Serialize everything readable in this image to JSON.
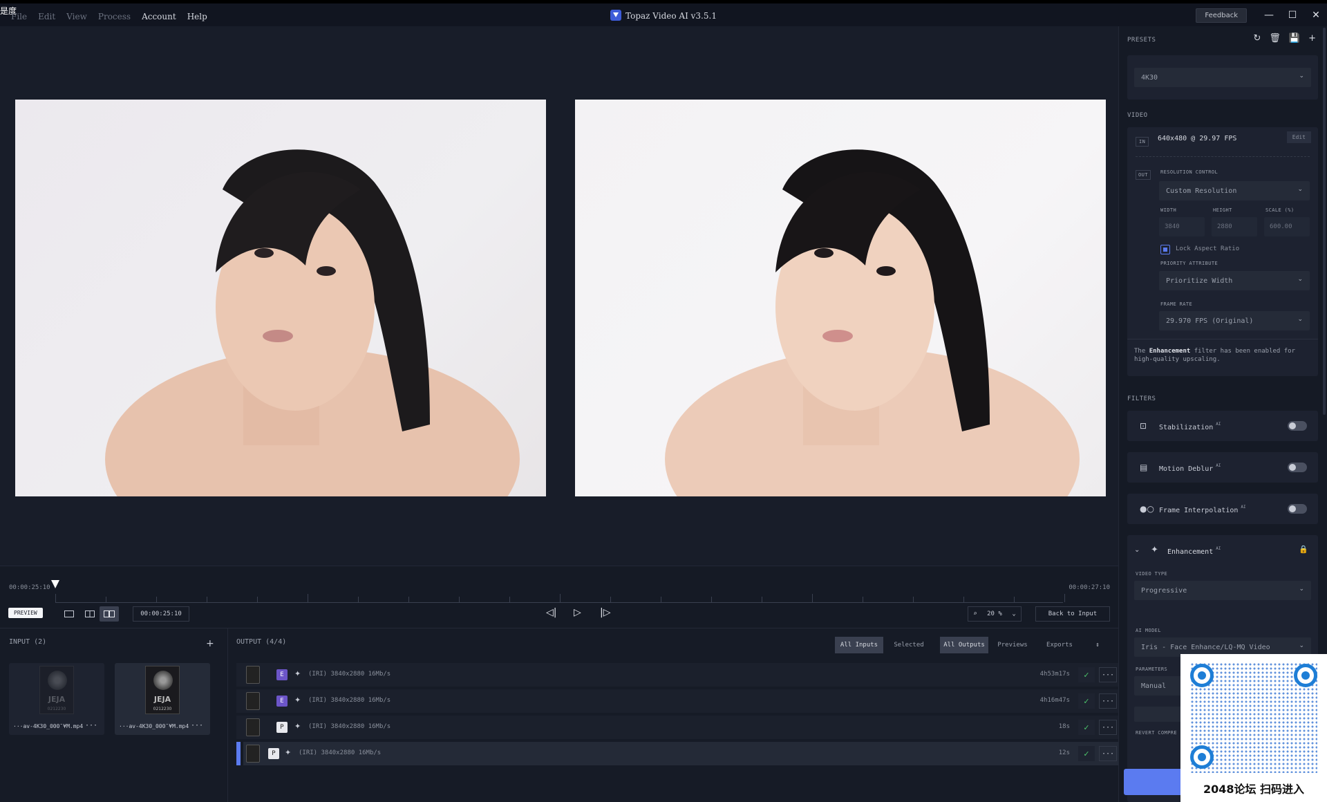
{
  "titlebar": {
    "watermark": "是度",
    "menu": [
      "File",
      "Edit",
      "View",
      "Process",
      "Account",
      "Help"
    ],
    "app_title": "Topaz Video AI  v3.5.1",
    "feedback": "Feedback",
    "minimize": "—",
    "maximize": "☐",
    "close": "✕"
  },
  "timeline": {
    "start_tc": "00:00:25:10",
    "end_tc": "00:00:27:10",
    "preview_label": "PREVIEW",
    "current_tc": "00:00:25:10",
    "zoom": "20 %",
    "back_to_input": "Back to Input"
  },
  "input": {
    "header": "INPUT (2)",
    "add": "+",
    "files": [
      {
        "name": "···av-4K30_000¯¥M.mp4",
        "thumb_text": "JEJA",
        "thumb_sub": "0212230",
        "more": "···"
      },
      {
        "name": "···av-4K30_000¯¥M.mp4",
        "thumb_text": "JEJA",
        "thumb_sub": "0212230",
        "more": "···"
      }
    ]
  },
  "output": {
    "header": "OUTPUT (4/4)",
    "filters": [
      "All Inputs",
      "Selected",
      "All Outputs",
      "Previews",
      "Exports"
    ],
    "sort_icon": "⇕",
    "rows": [
      {
        "tag": "E",
        "desc": "(IRI) 3840x2880 16Mb/s",
        "time": "4h53m17s",
        "check": "✓",
        "more": "···"
      },
      {
        "tag": "E",
        "desc": "(IRI) 3840x2880 16Mb/s",
        "time": "4h16m47s",
        "check": "✓",
        "more": "···"
      },
      {
        "tag": "P",
        "desc": "(IRI) 3840x2880 16Mb/s",
        "time": "18s",
        "check": "✓",
        "more": "···"
      },
      {
        "tag": "P",
        "desc": "(IRI) 3840x2880 16Mb/s",
        "time": "12s",
        "check": "✓",
        "more": "···"
      }
    ]
  },
  "sidebar": {
    "presets_header": "PRESETS",
    "preset_value": "4K30",
    "video_header": "VIDEO",
    "in_label": "IN",
    "in_info": "640x480 @ 29.97 FPS",
    "edit_label": "Edit",
    "out_label": "OUT",
    "resolution_control_label": "RESOLUTION CONTROL",
    "resolution_control_value": "Custom Resolution",
    "width_label": "WIDTH",
    "height_label": "HEIGHT",
    "scale_label": "SCALE (%)",
    "width_value": "3840",
    "height_value": "2880",
    "scale_value": "600.00",
    "lock_aspect": "Lock Aspect Ratio",
    "priority_label": "PRIORITY ATTRIBUTE",
    "priority_value": "Prioritize Width",
    "frame_rate_label": "FRAME RATE",
    "frame_rate_value": "29.970 FPS (Original)",
    "note_pre": "The ",
    "note_bold": "Enhancement",
    "note_post": " filter has been enabled for high-quality upscaling.",
    "filters_header": "FILTERS",
    "filters": [
      {
        "name": "Stabilization",
        "ai": "AI"
      },
      {
        "name": "Motion Deblur",
        "ai": "AI"
      },
      {
        "name": "Frame Interpolation",
        "ai": "AI"
      }
    ],
    "enhancement": {
      "name": "Enhancement",
      "ai": "AI",
      "video_type_label": "VIDEO TYPE",
      "video_type_value": "Progressive",
      "ai_model_label": "AI MODEL",
      "ai_model_value": "Iris - Face Enhance/LQ-MQ Video",
      "parameters_label": "PARAMETERS",
      "parameters_value": "Manual",
      "revert_label": "REVERT COMPRE"
    }
  },
  "qr": {
    "caption": "2048论坛 扫码进入"
  },
  "colors": {
    "accent": "#5b7bf0",
    "tag_e": "#6c55c8",
    "check": "#4cc46b",
    "bg": "#171c28"
  }
}
